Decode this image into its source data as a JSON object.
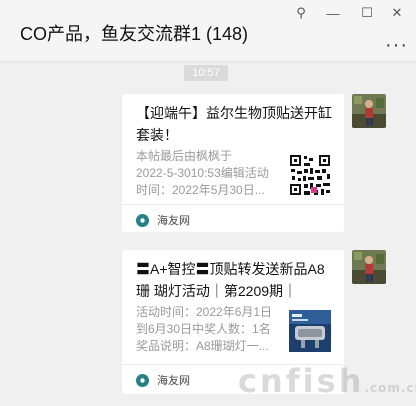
{
  "window": {
    "title": "CO产品，鱼友交流群1 (148)",
    "controls": {
      "pin": "⚲",
      "minimize": "—",
      "maximize": "☐",
      "close": "✕"
    },
    "more": "···"
  },
  "chat": {
    "timestamp": "10:57",
    "messages": [
      {
        "title": "【迎端午】益尔生物顶贴送开缸套装！",
        "desc": [
          "本帖最后由枫枫于",
          "2022-5-3010:53编辑活动",
          "时间：2022年5月30日..."
        ],
        "thumb_icon": "qr-code-icon",
        "source": "海友网"
      },
      {
        "title": "〓A+智控〓顶贴转发送新品A8珊 瑚灯活动｜第2209期｜",
        "desc": [
          "活动时间：2022年6月1日",
          "到6月30日中奖人数：1名",
          "奖品说明：A8珊瑚灯一..."
        ],
        "thumb_icon": "coral-lamp-icon",
        "source": "海友网"
      }
    ]
  },
  "watermark": {
    "main": "cnfish",
    "suffix": ".com.cn"
  },
  "colors": {
    "card_bg": "#ffffff",
    "chat_bg": "#f0f0f0",
    "source_icon": "#2a7f86"
  }
}
